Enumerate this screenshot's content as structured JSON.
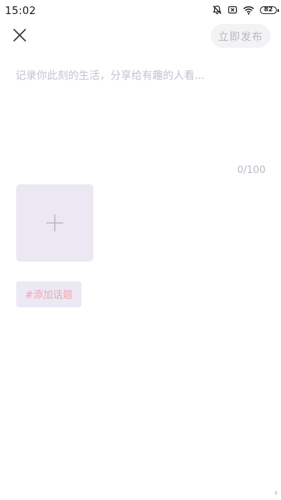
{
  "status_bar": {
    "time": "15:02",
    "battery": "82",
    "icons": [
      "bell-muted-icon",
      "sim-x-icon",
      "wifi-icon",
      "battery-icon"
    ]
  },
  "header": {
    "close_icon": "close-icon",
    "publish_label": "立即发布"
  },
  "composer": {
    "placeholder": "记录你此刻的生活，分享给有趣的人看...",
    "value": "",
    "counter": "0/100"
  },
  "media": {
    "add_icon": "plus-icon"
  },
  "topic": {
    "label": "#添加话题"
  },
  "footer": {
    "corner_mark": "5"
  },
  "colors": {
    "publish_bg": "#f3f3f5",
    "publish_text": "#b9b9bd",
    "placeholder": "#c4c0d3",
    "tile_bg": "#ebe8f3",
    "topic_text": "#f0a6ae"
  }
}
